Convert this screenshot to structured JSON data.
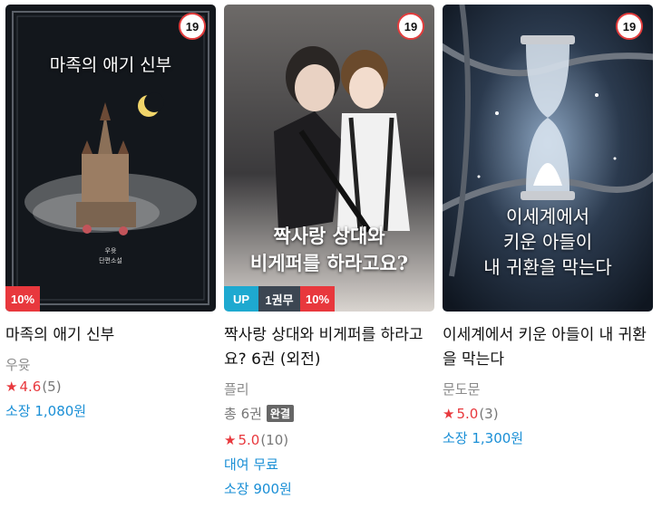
{
  "books": [
    {
      "cover_title": "마족의 애기 신부",
      "age_badge": "19",
      "tags": [
        "10%"
      ],
      "title": "마족의 애기 신부",
      "author": "우윳",
      "rating": "4.6",
      "rating_count": "(5)",
      "price": "소장 1,080원",
      "colors": {
        "bg": "#14181e"
      }
    },
    {
      "cover_title_line1": "짝사랑 상대와",
      "cover_title_line2": "비게퍼를 하라고요?",
      "age_badge": "19",
      "tags": [
        "UP",
        "1권무",
        "10%"
      ],
      "title": "짝사랑 상대와 비게퍼를 하라고요? 6권 (외전)",
      "author": "플리",
      "volume_info": "총 6권",
      "complete_label": "완결",
      "rating": "5.0",
      "rating_count": "(10)",
      "rent": "대여 무료",
      "price": "소장 900원"
    },
    {
      "cover_title_line1": "이세계에서",
      "cover_title_line2": "키운 아들이",
      "cover_title_line3": "내 귀환을 막는다",
      "age_badge": "19",
      "tags": [],
      "title": "이세계에서 키운 아들이 내 귀환을 막는다",
      "author": "문도문",
      "rating": "5.0",
      "rating_count": "(3)",
      "price": "소장 1,300원"
    }
  ],
  "icons": {
    "star": "star-icon"
  },
  "colors": {
    "accent_red": "#e8383d",
    "price_blue": "#1a8fd6",
    "up_blue": "#1ea9d0"
  }
}
